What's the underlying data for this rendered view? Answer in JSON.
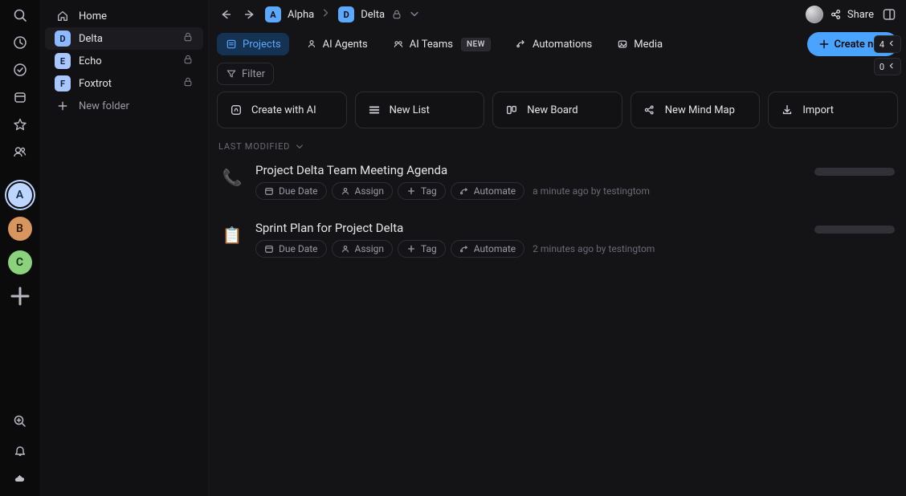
{
  "rail": {
    "workspaces": [
      {
        "letter": "A",
        "bg": "#bcd6ff",
        "fg": "#1b2a46",
        "selected": true
      },
      {
        "letter": "B",
        "bg": "#d8955e",
        "fg": "#2f1a0a",
        "selected": false
      },
      {
        "letter": "C",
        "bg": "#8bd27c",
        "fg": "#142a10",
        "selected": false
      }
    ]
  },
  "sidebar": {
    "home_label": "Home",
    "items": [
      {
        "letter": "D",
        "label": "Delta",
        "bg": "#8eb8ff",
        "fg": "#0e223f",
        "locked": true,
        "active": true
      },
      {
        "letter": "E",
        "label": "Echo",
        "bg": "#a9c7ff",
        "fg": "#0e223f",
        "locked": true,
        "active": false
      },
      {
        "letter": "F",
        "label": "Foxtrot",
        "bg": "#a9c7ff",
        "fg": "#0e223f",
        "locked": true,
        "active": false
      }
    ],
    "new_folder_label": "New folder"
  },
  "breadcrumb": {
    "ws_letter": "A",
    "ws_label": "Alpha",
    "ws_bg": "#5aa9ff",
    "ws_fg": "#0b0b0c",
    "folder_letter": "D",
    "folder_label": "Delta",
    "folder_bg": "#5aa9ff",
    "folder_fg": "#0b0b0c"
  },
  "header": {
    "share_label": "Share"
  },
  "tabs": [
    {
      "label": "Projects",
      "icon": "projects",
      "active": true,
      "badge": null
    },
    {
      "label": "AI Agents",
      "icon": "agents",
      "active": false,
      "badge": null
    },
    {
      "label": "AI Teams",
      "icon": "aiteams",
      "active": false,
      "badge": "NEW"
    },
    {
      "label": "Automations",
      "icon": "automations",
      "active": false,
      "badge": null
    },
    {
      "label": "Media",
      "icon": "media",
      "active": false,
      "badge": null
    }
  ],
  "create_new_label": "Create new",
  "filter_label": "Filter",
  "create_cards": [
    {
      "label": "Create with AI",
      "icon": "ai"
    },
    {
      "label": "New List",
      "icon": "list"
    },
    {
      "label": "New Board",
      "icon": "board"
    },
    {
      "label": "New Mind Map",
      "icon": "mindmap"
    },
    {
      "label": "Import",
      "icon": "import"
    }
  ],
  "sort_label": "LAST MODIFIED",
  "right_counts": {
    "top": "4",
    "bottom": "0"
  },
  "item_pills": [
    {
      "label": "Due Date",
      "icon": "calendar"
    },
    {
      "label": "Assign",
      "icon": "user"
    },
    {
      "label": "Tag",
      "icon": "plus"
    },
    {
      "label": "Automate",
      "icon": "path"
    }
  ],
  "items": [
    {
      "emoji": "📞",
      "title": "Project Delta Team Meeting Agenda",
      "ts": "a minute ago by testingtom"
    },
    {
      "emoji": "📋",
      "title": "Sprint Plan for Project Delta",
      "ts": "2 minutes ago by testingtom"
    }
  ]
}
